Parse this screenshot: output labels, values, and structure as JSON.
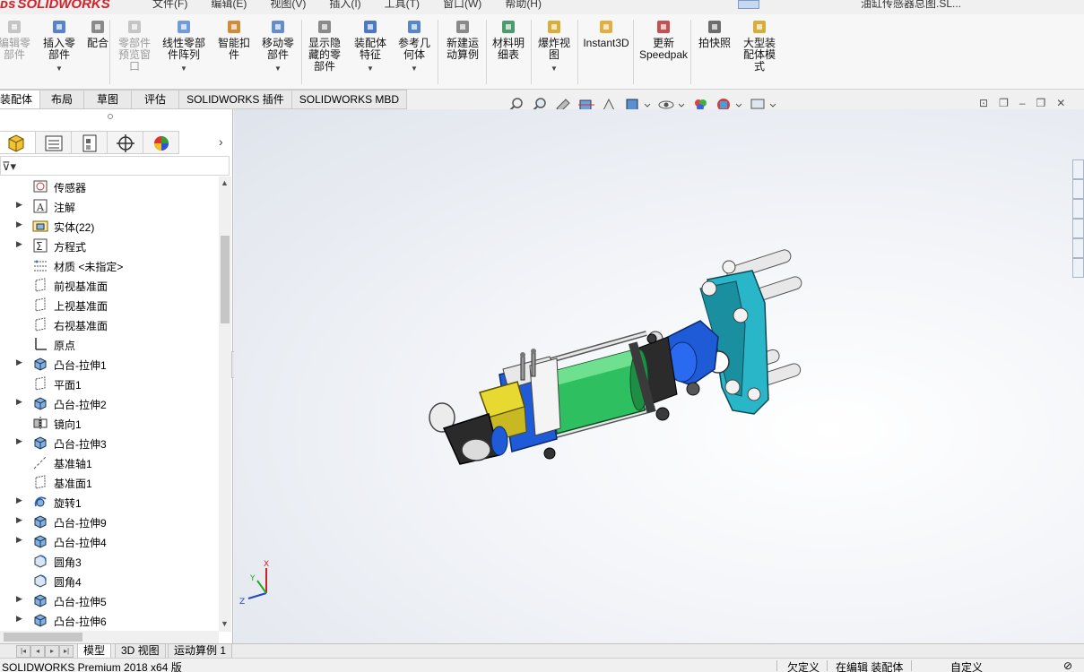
{
  "app": {
    "logo": "SOLIDWORKS",
    "menu": [
      "文件(F)",
      "编辑(E)",
      "视图(V)",
      "插入(I)",
      "工具(T)",
      "窗口(W)",
      "帮助(H)"
    ],
    "doc_title": "油缸传感器总图.SL..."
  },
  "ribbon": {
    "buttons": [
      {
        "label": "编辑零\n部件",
        "icon": "edit-component-icon",
        "disabled": true
      },
      {
        "label": "插入零\n部件",
        "icon": "insert-component-icon",
        "disabled": false,
        "caret": true
      },
      {
        "label": "配合",
        "icon": "mate-icon",
        "disabled": false
      },
      {
        "label": "零部件\n预览窗\n口",
        "icon": "component-preview-icon",
        "disabled": true
      },
      {
        "label": "线性零部\n件阵列",
        "icon": "linear-pattern-icon",
        "disabled": false,
        "caret": true
      },
      {
        "label": "智能扣\n件",
        "icon": "smart-fastener-icon",
        "disabled": false
      },
      {
        "label": "移动零\n部件",
        "icon": "move-component-icon",
        "disabled": false,
        "caret": true
      },
      {
        "label": "显示隐\n藏的零\n部件",
        "icon": "show-hidden-icon",
        "disabled": false
      },
      {
        "label": "装配体\n特征",
        "icon": "assembly-feature-icon",
        "disabled": false,
        "caret": true
      },
      {
        "label": "参考几\n何体",
        "icon": "reference-geometry-icon",
        "disabled": false,
        "caret": true
      },
      {
        "label": "新建运\n动算例",
        "icon": "new-motion-study-icon",
        "disabled": false
      },
      {
        "label": "材料明\n细表",
        "icon": "bom-icon",
        "disabled": false
      },
      {
        "label": "爆炸视\n图",
        "icon": "exploded-view-icon",
        "disabled": false,
        "caret": true
      },
      {
        "label": "Instant3D",
        "icon": "instant3d-icon",
        "disabled": false
      },
      {
        "label": "更新\nSpeedpak",
        "icon": "speedpak-icon",
        "disabled": false
      },
      {
        "label": "拍快照",
        "icon": "snapshot-icon",
        "disabled": false
      },
      {
        "label": "大型装\n配体模\n式",
        "icon": "large-assembly-icon",
        "disabled": false
      }
    ]
  },
  "tabs": [
    "装配体",
    "布局",
    "草图",
    "评估",
    "SOLIDWORKS 插件",
    "SOLIDWORKS MBD"
  ],
  "window_controls": {
    "restore": "⊡",
    "min": "–",
    "max": "❐",
    "close": "✕"
  },
  "tree": {
    "items": [
      {
        "label": "传感器",
        "icon": "sensor-icon",
        "expander": false
      },
      {
        "label": "注解",
        "icon": "annotation-icon",
        "expander": true
      },
      {
        "label": "实体(22)",
        "icon": "solid-bodies-icon",
        "expander": true
      },
      {
        "label": "方程式",
        "icon": "equation-icon",
        "expander": true
      },
      {
        "label": "材质 <未指定>",
        "icon": "material-icon",
        "expander": false
      },
      {
        "label": "前视基准面",
        "icon": "plane-icon",
        "expander": false
      },
      {
        "label": "上视基准面",
        "icon": "plane-icon",
        "expander": false
      },
      {
        "label": "右视基准面",
        "icon": "plane-icon",
        "expander": false
      },
      {
        "label": "原点",
        "icon": "origin-icon",
        "expander": false
      },
      {
        "label": "凸台-拉伸1",
        "icon": "extrude-icon",
        "expander": true
      },
      {
        "label": "平面1",
        "icon": "plane-icon",
        "expander": false
      },
      {
        "label": "凸台-拉伸2",
        "icon": "extrude-icon",
        "expander": true
      },
      {
        "label": "镜向1",
        "icon": "mirror-icon",
        "expander": false
      },
      {
        "label": "凸台-拉伸3",
        "icon": "extrude-icon",
        "expander": true
      },
      {
        "label": "基准轴1",
        "icon": "axis-icon",
        "expander": false
      },
      {
        "label": "基准面1",
        "icon": "plane-icon",
        "expander": false
      },
      {
        "label": "旋转1",
        "icon": "revolve-icon",
        "expander": true
      },
      {
        "label": "凸台-拉伸9",
        "icon": "extrude-icon",
        "expander": true
      },
      {
        "label": "凸台-拉伸4",
        "icon": "extrude-icon",
        "expander": true
      },
      {
        "label": "圆角3",
        "icon": "fillet-icon",
        "expander": false
      },
      {
        "label": "圆角4",
        "icon": "fillet-icon",
        "expander": false
      },
      {
        "label": "凸台-拉伸5",
        "icon": "extrude-icon",
        "expander": true
      },
      {
        "label": "凸台-拉伸6",
        "icon": "extrude-icon",
        "expander": true
      }
    ]
  },
  "bottom_tabs": [
    "模型",
    "3D 视图",
    "运动算例 1"
  ],
  "status": {
    "product": "SOLIDWORKS Premium 2018 x64 版",
    "definition": "欠定义",
    "editing": "在编辑 装配体",
    "units": "自定义"
  },
  "triad": {
    "x": "X",
    "y": "Y",
    "z": "Z"
  },
  "colors": {
    "accent_red": "#d2232a",
    "ribbon_bg": "#f7f7f7",
    "cylinder_green": "#2ec060",
    "part_blue": "#1f5bd6",
    "flange_teal": "#2ab6c9",
    "bracket_yellow": "#e8d832"
  }
}
